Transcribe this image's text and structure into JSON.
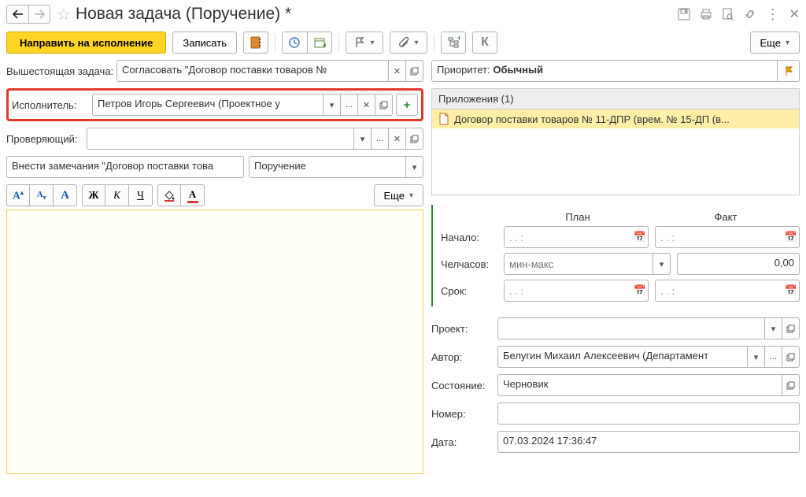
{
  "title": "Новая задача (Поручение) *",
  "toolbar": {
    "submit": "Направить на исполнение",
    "record": "Записать",
    "more": "Еще"
  },
  "form": {
    "parent_task_label": "Вышестоящая задача:",
    "parent_task_value": "Согласовать \"Договор поставки товаров  №",
    "executor_label": "Исполнитель:",
    "executor_value": "Петров Игорь Сергеевич (Проектное у",
    "checker_label": "Проверяющий:",
    "checker_value": "",
    "subject_value": "Внести замечания \"Договор поставки това",
    "type_value": "Поручение"
  },
  "rt_more": "Еще",
  "priority": {
    "label": "Приоритет:",
    "value": "Обычный"
  },
  "attachments": {
    "header": "Приложения (1)",
    "item1": "Договор поставки товаров  № 11-ДПР (врем. № 15-ДП (в..."
  },
  "planfact": {
    "plan": "План",
    "fact": "Факт",
    "start_label": "Начало:",
    "hours_label": "Челчасов:",
    "hours_placeholder": "мин-макс",
    "hours_fact": "0,00",
    "deadline_label": "Срок:",
    "date_placeholder": ".  .        :"
  },
  "meta": {
    "project_label": "Проект:",
    "project_value": "",
    "author_label": "Автор:",
    "author_value": "Белугин Михаил Алексеевич (Департамент",
    "state_label": "Состояние:",
    "state_value": "Черновик",
    "number_label": "Номер:",
    "number_value": "",
    "date_label": "Дата:",
    "date_value": "07.03.2024 17:36:47"
  }
}
